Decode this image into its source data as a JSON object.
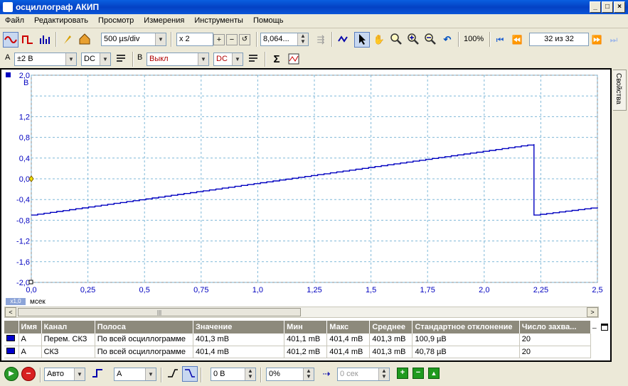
{
  "window": {
    "title": "осциллограф АКИП",
    "min_glyph": "_",
    "max_glyph": "□",
    "close_glyph": "×"
  },
  "menu": [
    "Файл",
    "Редактировать",
    "Просмотр",
    "Измерения",
    "Инструменты",
    "Помощь"
  ],
  "toolbar1": {
    "timebase": "500 µs/div",
    "zoom": "x 2",
    "samples": "8,064...",
    "zoom_percent": "100%",
    "capture_counter": "32 из 32"
  },
  "toolbar2": {
    "chA_label": "A",
    "chA_range": "±2 В",
    "chA_coupling": "DC",
    "chB_label": "B",
    "chB_range": "Выкл",
    "chB_coupling": "DC"
  },
  "side_tab": "Свойства",
  "plot": {
    "y_unit": "В",
    "x_unit": "мсек",
    "x_scale_badge": "x1,0",
    "grid_color": "#7fb8d8",
    "trace_color": "#0000c0"
  },
  "chart_data": {
    "type": "line",
    "xlabel": "мсек",
    "ylabel": "В",
    "xlim": [
      0,
      2.5
    ],
    "ylim": [
      -2.0,
      2.0
    ],
    "x_ticks": [
      "0,0",
      "0,25",
      "0,5",
      "0,75",
      "1,0",
      "1,25",
      "1,5",
      "1,75",
      "2,0",
      "2,25",
      "2,5"
    ],
    "y_ticks": [
      "2,0",
      "1,2",
      "0,8",
      "0,4",
      "0,0",
      "-0,4",
      "-0,8",
      "-1,2",
      "-1,6",
      "-2,0"
    ],
    "y_tick_values": [
      2.0,
      1.2,
      0.8,
      0.4,
      0.0,
      -0.4,
      -0.8,
      -1.2,
      -1.6,
      -2.0
    ],
    "grid": true,
    "series": [
      {
        "name": "A",
        "points": [
          [
            0,
            -0.7
          ],
          [
            2.22,
            0.67
          ],
          [
            2.22,
            -0.7
          ],
          [
            2.5,
            -0.55
          ]
        ]
      }
    ]
  },
  "measurements": {
    "headers": [
      "Имя",
      "Канал",
      "Полоса",
      "Значение",
      "Мин",
      "Макс",
      "Среднее",
      "Стандартное отклонение",
      "Число захва..."
    ],
    "rows": [
      [
        "A",
        "Перем. СКЗ",
        "По всей осциллограмме",
        "401,3 mВ",
        "401,1 mВ",
        "401,4 mВ",
        "401,3 mВ",
        "100,9 µВ",
        "20"
      ],
      [
        "A",
        "СКЗ",
        "По всей осциллограмме",
        "401,4 mВ",
        "401,2 mВ",
        "401,4 mВ",
        "401,3 mВ",
        "40,78 µВ",
        "20"
      ]
    ]
  },
  "bottom": {
    "trigger_mode": "Авто",
    "trigger_source": "A",
    "trigger_level": "0 В",
    "pre_trigger": "0%",
    "delay": "0 сек"
  }
}
